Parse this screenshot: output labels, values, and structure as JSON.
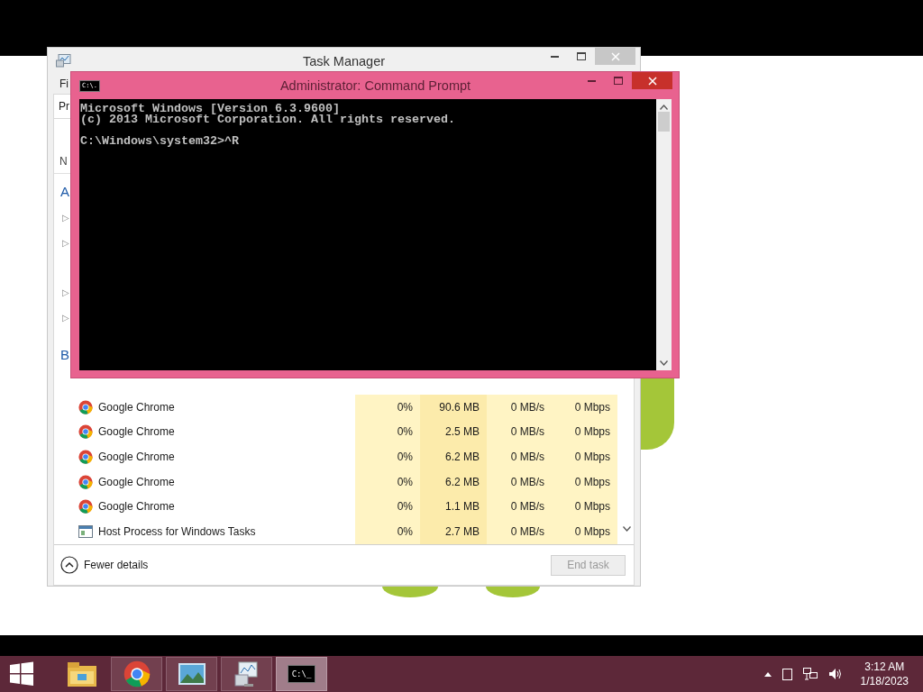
{
  "task_manager": {
    "title": "Task Manager",
    "menu_fragment": "Fi",
    "tab_fragment": "Pr",
    "column_fragment": "N",
    "groups": [
      {
        "label": "A",
        "items": [
          {
            "kind": "expandable",
            "glyph": "▷"
          },
          {
            "kind": "expandable",
            "glyph": "▷"
          },
          {
            "kind": "plain"
          },
          {
            "kind": "expandable",
            "glyph": "▷"
          },
          {
            "kind": "expandable",
            "glyph": "▷"
          }
        ]
      },
      {
        "label": "B"
      }
    ],
    "rows": [
      {
        "kind": "chrome",
        "name": "Google Chrome",
        "cpu": "0%",
        "memory": "90.6 MB",
        "disk": "0 MB/s",
        "network": "0 Mbps"
      },
      {
        "kind": "chrome",
        "name": "Google Chrome",
        "cpu": "0%",
        "memory": "2.5 MB",
        "disk": "0 MB/s",
        "network": "0 Mbps"
      },
      {
        "kind": "chrome",
        "name": "Google Chrome",
        "cpu": "0%",
        "memory": "6.2 MB",
        "disk": "0 MB/s",
        "network": "0 Mbps"
      },
      {
        "kind": "chrome",
        "name": "Google Chrome",
        "cpu": "0%",
        "memory": "6.2 MB",
        "disk": "0 MB/s",
        "network": "0 Mbps"
      },
      {
        "kind": "chrome",
        "name": "Google Chrome",
        "cpu": "0%",
        "memory": "1.1 MB",
        "disk": "0 MB/s",
        "network": "0 Mbps"
      },
      {
        "kind": "host",
        "name": "Host Process for Windows Tasks",
        "cpu": "0%",
        "memory": "2.7 MB",
        "disk": "0 MB/s",
        "network": "0 Mbps"
      }
    ],
    "fewer_details": "Fewer details",
    "end_task": {
      "label": "End task",
      "disabled": true
    }
  },
  "command_prompt": {
    "title": "Administrator:  Command Prompt",
    "icon_text": "C:\\.",
    "blocks": [
      [
        "Microsoft Windows [Version 6.3.9600]",
        "(c) 2013 Microsoft Corporation. All rights reserved."
      ],
      [
        "C:\\Windows\\system32>^R"
      ]
    ]
  },
  "taskbar": {
    "apps": [
      {
        "kind": "explorer",
        "running": false,
        "selected": false
      },
      {
        "kind": "chrome",
        "running": true,
        "selected": false
      },
      {
        "kind": "photos",
        "running": true,
        "selected": false
      },
      {
        "kind": "monitor",
        "running": true,
        "selected": false
      },
      {
        "kind": "cmd",
        "running": true,
        "selected": true,
        "icon_text": "C:\\_"
      }
    ],
    "time": "3:12 AM",
    "date": "1/18/2023"
  }
}
